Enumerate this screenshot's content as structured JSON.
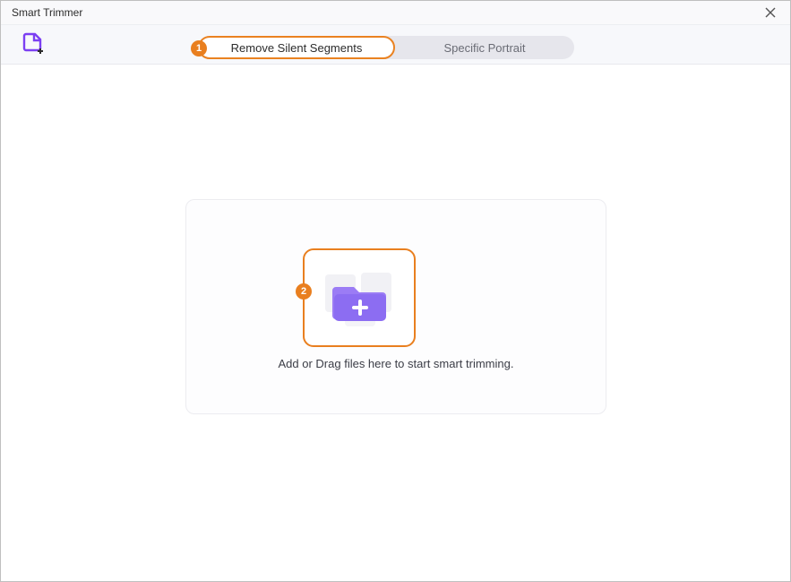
{
  "window": {
    "title": "Smart Trimmer"
  },
  "tabs": {
    "remove_silent": "Remove Silent Segments",
    "specific_portrait": "Specific Portrait"
  },
  "steps": {
    "one": "1",
    "two": "2"
  },
  "dropzone": {
    "hint": "Add or Drag files here to start smart trimming."
  }
}
